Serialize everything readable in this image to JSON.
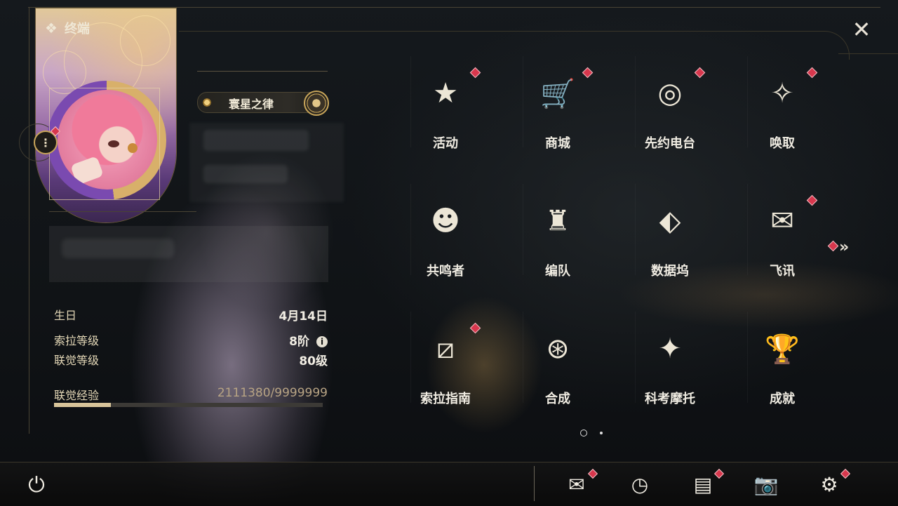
{
  "header": {
    "title": "终端",
    "close_label": "✕"
  },
  "profile": {
    "badge_label": "寰星之律",
    "more_label": "⋮",
    "stats": [
      {
        "key": "生日",
        "value": "4月14日"
      },
      {
        "key": "索拉等级",
        "value": "8阶",
        "info": "i"
      },
      {
        "key": "联觉等级",
        "value": "80级"
      }
    ],
    "exp": {
      "key": "联觉经验",
      "value": "2111380/9999999",
      "progress": 0.211
    }
  },
  "menu": {
    "tiles": [
      {
        "label": "活动",
        "icon": "event-icon",
        "glyph": "★",
        "badge": true
      },
      {
        "label": "商城",
        "icon": "shop-icon",
        "glyph": "🛒",
        "badge": true
      },
      {
        "label": "先约电台",
        "icon": "radio-icon",
        "glyph": "◎",
        "badge": true
      },
      {
        "label": "唤取",
        "icon": "summon-icon",
        "glyph": "✧",
        "badge": true
      },
      {
        "label": "共鸣者",
        "icon": "resonator-icon",
        "glyph": "☻",
        "badge": false
      },
      {
        "label": "编队",
        "icon": "team-icon",
        "glyph": "♜",
        "badge": false
      },
      {
        "label": "数据坞",
        "icon": "databank-icon",
        "glyph": "⬖",
        "badge": false
      },
      {
        "label": "飞讯",
        "icon": "message-icon",
        "glyph": "✉",
        "badge": true
      },
      {
        "label": "索拉指南",
        "icon": "guide-icon",
        "glyph": "⧄",
        "badge": true
      },
      {
        "label": "合成",
        "icon": "synthesis-icon",
        "glyph": "⊛",
        "badge": false
      },
      {
        "label": "科考摩托",
        "icon": "motorbike-icon",
        "glyph": "✦",
        "badge": false
      },
      {
        "label": "成就",
        "icon": "trophy-icon",
        "glyph": "🏆",
        "badge": false
      }
    ],
    "next_label": "»",
    "pages": 2,
    "current_page": 1
  },
  "bottom_bar": {
    "power_glyph": "⏻",
    "items": [
      {
        "icon": "mail-icon",
        "glyph": "✉",
        "badge": true
      },
      {
        "icon": "clock-icon",
        "glyph": "◷",
        "badge": false
      },
      {
        "icon": "notice-icon",
        "glyph": "▤",
        "badge": true
      },
      {
        "icon": "camera-icon",
        "glyph": "📷",
        "badge": false
      },
      {
        "icon": "settings-icon",
        "glyph": "⚙",
        "badge": true
      }
    ]
  },
  "colors": {
    "accent_gold": "#c9a65a",
    "badge_red": "#d8374d",
    "text_light": "#f0ece2"
  }
}
